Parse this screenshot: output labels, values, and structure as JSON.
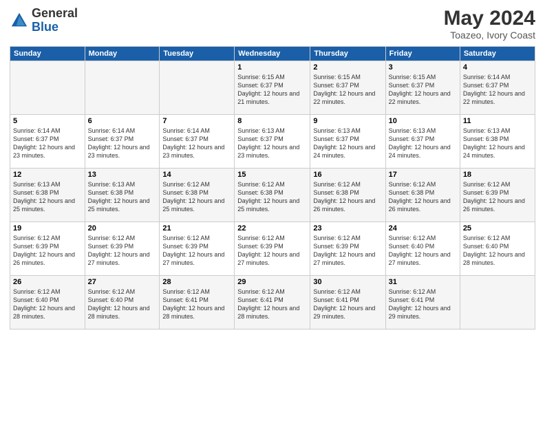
{
  "header": {
    "logo_general": "General",
    "logo_blue": "Blue",
    "month_year": "May 2024",
    "location": "Toazeo, Ivory Coast"
  },
  "days_of_week": [
    "Sunday",
    "Monday",
    "Tuesday",
    "Wednesday",
    "Thursday",
    "Friday",
    "Saturday"
  ],
  "weeks": [
    [
      {
        "day": "",
        "info": ""
      },
      {
        "day": "",
        "info": ""
      },
      {
        "day": "",
        "info": ""
      },
      {
        "day": "1",
        "info": "Sunrise: 6:15 AM\nSunset: 6:37 PM\nDaylight: 12 hours\nand 21 minutes."
      },
      {
        "day": "2",
        "info": "Sunrise: 6:15 AM\nSunset: 6:37 PM\nDaylight: 12 hours\nand 22 minutes."
      },
      {
        "day": "3",
        "info": "Sunrise: 6:15 AM\nSunset: 6:37 PM\nDaylight: 12 hours\nand 22 minutes."
      },
      {
        "day": "4",
        "info": "Sunrise: 6:14 AM\nSunset: 6:37 PM\nDaylight: 12 hours\nand 22 minutes."
      }
    ],
    [
      {
        "day": "5",
        "info": "Sunrise: 6:14 AM\nSunset: 6:37 PM\nDaylight: 12 hours\nand 23 minutes."
      },
      {
        "day": "6",
        "info": "Sunrise: 6:14 AM\nSunset: 6:37 PM\nDaylight: 12 hours\nand 23 minutes."
      },
      {
        "day": "7",
        "info": "Sunrise: 6:14 AM\nSunset: 6:37 PM\nDaylight: 12 hours\nand 23 minutes."
      },
      {
        "day": "8",
        "info": "Sunrise: 6:13 AM\nSunset: 6:37 PM\nDaylight: 12 hours\nand 23 minutes."
      },
      {
        "day": "9",
        "info": "Sunrise: 6:13 AM\nSunset: 6:37 PM\nDaylight: 12 hours\nand 24 minutes."
      },
      {
        "day": "10",
        "info": "Sunrise: 6:13 AM\nSunset: 6:37 PM\nDaylight: 12 hours\nand 24 minutes."
      },
      {
        "day": "11",
        "info": "Sunrise: 6:13 AM\nSunset: 6:38 PM\nDaylight: 12 hours\nand 24 minutes."
      }
    ],
    [
      {
        "day": "12",
        "info": "Sunrise: 6:13 AM\nSunset: 6:38 PM\nDaylight: 12 hours\nand 25 minutes."
      },
      {
        "day": "13",
        "info": "Sunrise: 6:13 AM\nSunset: 6:38 PM\nDaylight: 12 hours\nand 25 minutes."
      },
      {
        "day": "14",
        "info": "Sunrise: 6:12 AM\nSunset: 6:38 PM\nDaylight: 12 hours\nand 25 minutes."
      },
      {
        "day": "15",
        "info": "Sunrise: 6:12 AM\nSunset: 6:38 PM\nDaylight: 12 hours\nand 25 minutes."
      },
      {
        "day": "16",
        "info": "Sunrise: 6:12 AM\nSunset: 6:38 PM\nDaylight: 12 hours\nand 26 minutes."
      },
      {
        "day": "17",
        "info": "Sunrise: 6:12 AM\nSunset: 6:38 PM\nDaylight: 12 hours\nand 26 minutes."
      },
      {
        "day": "18",
        "info": "Sunrise: 6:12 AM\nSunset: 6:39 PM\nDaylight: 12 hours\nand 26 minutes."
      }
    ],
    [
      {
        "day": "19",
        "info": "Sunrise: 6:12 AM\nSunset: 6:39 PM\nDaylight: 12 hours\nand 26 minutes."
      },
      {
        "day": "20",
        "info": "Sunrise: 6:12 AM\nSunset: 6:39 PM\nDaylight: 12 hours\nand 27 minutes."
      },
      {
        "day": "21",
        "info": "Sunrise: 6:12 AM\nSunset: 6:39 PM\nDaylight: 12 hours\nand 27 minutes."
      },
      {
        "day": "22",
        "info": "Sunrise: 6:12 AM\nSunset: 6:39 PM\nDaylight: 12 hours\nand 27 minutes."
      },
      {
        "day": "23",
        "info": "Sunrise: 6:12 AM\nSunset: 6:39 PM\nDaylight: 12 hours\nand 27 minutes."
      },
      {
        "day": "24",
        "info": "Sunrise: 6:12 AM\nSunset: 6:40 PM\nDaylight: 12 hours\nand 27 minutes."
      },
      {
        "day": "25",
        "info": "Sunrise: 6:12 AM\nSunset: 6:40 PM\nDaylight: 12 hours\nand 28 minutes."
      }
    ],
    [
      {
        "day": "26",
        "info": "Sunrise: 6:12 AM\nSunset: 6:40 PM\nDaylight: 12 hours\nand 28 minutes."
      },
      {
        "day": "27",
        "info": "Sunrise: 6:12 AM\nSunset: 6:40 PM\nDaylight: 12 hours\nand 28 minutes."
      },
      {
        "day": "28",
        "info": "Sunrise: 6:12 AM\nSunset: 6:41 PM\nDaylight: 12 hours\nand 28 minutes."
      },
      {
        "day": "29",
        "info": "Sunrise: 6:12 AM\nSunset: 6:41 PM\nDaylight: 12 hours\nand 28 minutes."
      },
      {
        "day": "30",
        "info": "Sunrise: 6:12 AM\nSunset: 6:41 PM\nDaylight: 12 hours\nand 29 minutes."
      },
      {
        "day": "31",
        "info": "Sunrise: 6:12 AM\nSunset: 6:41 PM\nDaylight: 12 hours\nand 29 minutes."
      },
      {
        "day": "",
        "info": ""
      }
    ]
  ]
}
